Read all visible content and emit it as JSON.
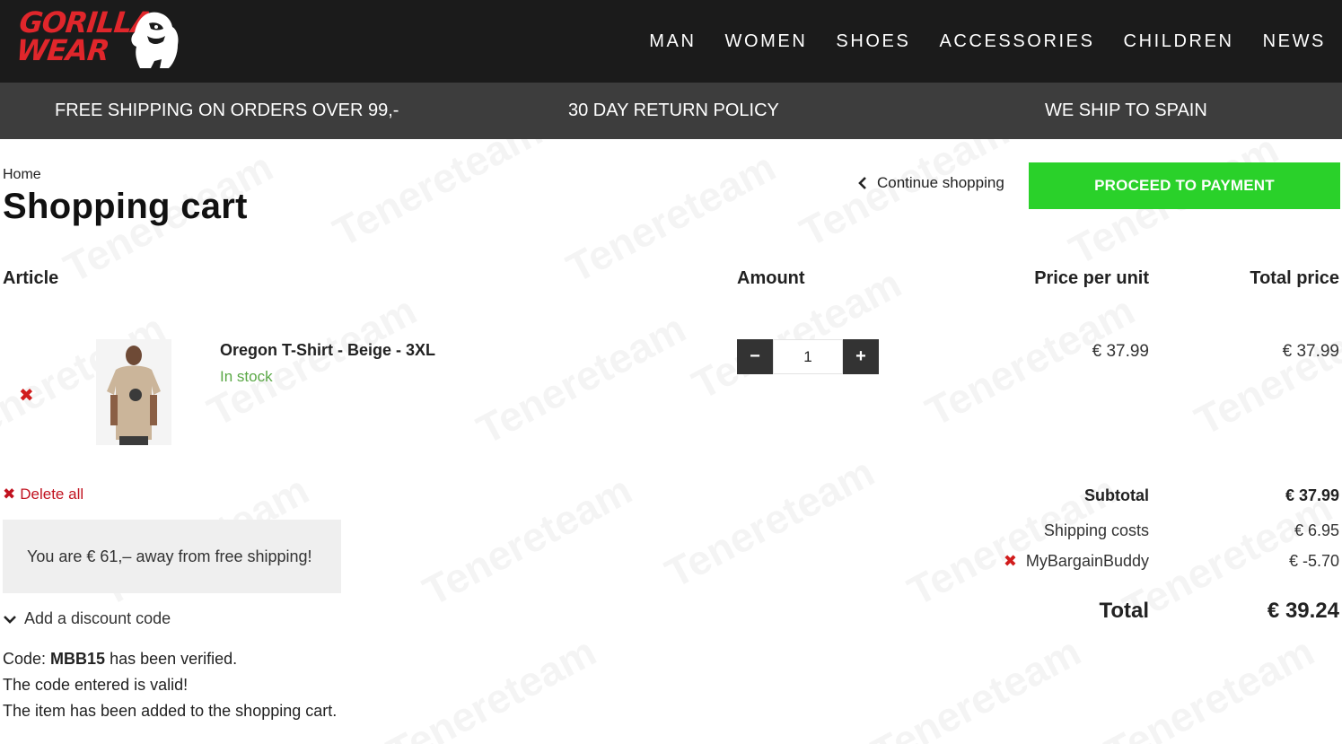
{
  "brand": {
    "logo_line1": "GORILLA",
    "logo_line2": "WEAR"
  },
  "nav": {
    "items": [
      "MAN",
      "WOMEN",
      "SHOES",
      "ACCESSORIES",
      "CHILDREN",
      "NEWS"
    ]
  },
  "promo": {
    "free_shipping": "FREE SHIPPING ON ORDERS OVER 99,-",
    "return_policy": "30 DAY RETURN POLICY",
    "ship_to": "WE SHIP TO SPAIN"
  },
  "breadcrumb": {
    "home": "Home"
  },
  "page": {
    "title": "Shopping cart"
  },
  "actions": {
    "continue_label": "Continue shopping",
    "proceed_label": "PROCEED TO PAYMENT"
  },
  "table": {
    "headers": {
      "article": "Article",
      "amount": "Amount",
      "price_per_unit": "Price per unit",
      "total_price": "Total price"
    }
  },
  "cart_item": {
    "name": "Oregon T-Shirt - Beige - 3XL",
    "stock": "In stock",
    "quantity": "1",
    "price_per_unit": "€ 37.99",
    "total_price": "€ 37.99",
    "minus_symbol": "−",
    "plus_symbol": "+",
    "remove_symbol": "✖"
  },
  "cart_actions": {
    "delete_all_symbol": "✖",
    "delete_all_label": "Delete all"
  },
  "free_shipping_notice": "You are € 61,– away from free shipping!",
  "discount": {
    "toggle_label": "Add a discount code",
    "code_prefix": "Code: ",
    "code": "MBB15",
    "code_suffix": " has been verified.",
    "valid_message": "The code entered is valid!",
    "added_message": "The item has been added to the shopping cart."
  },
  "summary": {
    "subtotal_label": "Subtotal",
    "subtotal_value": "€ 37.99",
    "shipping_label": "Shipping costs",
    "shipping_value": "€ 6.95",
    "coupon_remove_symbol": "✖",
    "coupon_label": "MyBargainBuddy",
    "coupon_value": "€ -5.70",
    "total_label": "Total",
    "total_value": "€ 39.24"
  },
  "watermark": "Tenereteam",
  "colors": {
    "header_bg": "#1b1b1b",
    "promo_bg": "#3d3d3d",
    "proceed_green": "#2ad12a",
    "logo_red": "#e0262b",
    "remove_red": "#d11c1c",
    "stock_green": "#5aa846"
  }
}
